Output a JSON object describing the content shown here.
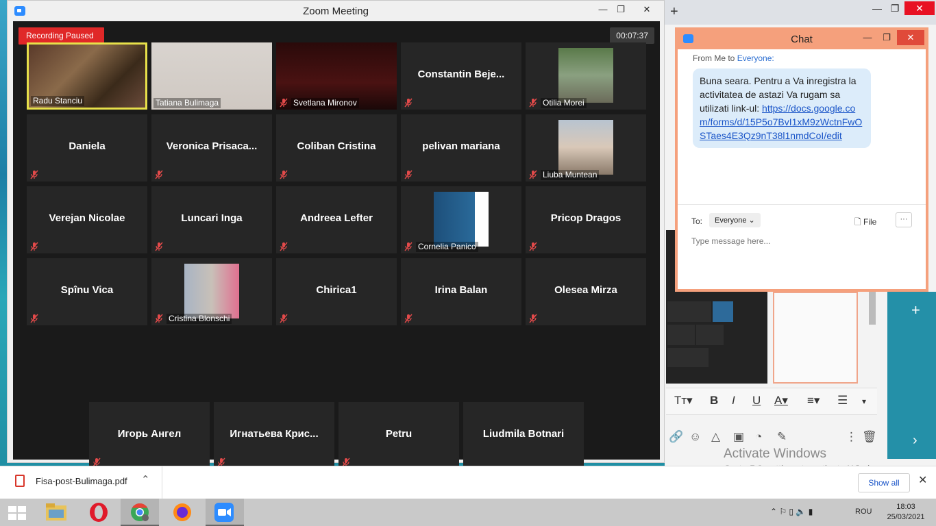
{
  "zoom": {
    "title": "Zoom Meeting",
    "recording_status": "Recording Paused",
    "timer": "00:07:37",
    "participants": [
      {
        "name": "Radu Stanciu",
        "display": "video",
        "active": true
      },
      {
        "name": "Tatiana Bulimaga",
        "display": "video"
      },
      {
        "name": "Svetlana Mironov",
        "display": "video"
      },
      {
        "name": "Constantin  Beje...",
        "display": "name"
      },
      {
        "name": "Otilia Morei",
        "display": "photo"
      },
      {
        "name": "Daniela",
        "display": "name"
      },
      {
        "name": "Veronica  Prisaca...",
        "display": "name"
      },
      {
        "name": "Coliban Cristina",
        "display": "name"
      },
      {
        "name": "pelivan mariana",
        "display": "name"
      },
      {
        "name": "Liuba Muntean",
        "display": "photo"
      },
      {
        "name": "Verejan Nicolae",
        "display": "name"
      },
      {
        "name": "Luncari Inga",
        "display": "name"
      },
      {
        "name": "Andreea Lefter",
        "display": "name"
      },
      {
        "name": "Cornelia Panico",
        "display": "photo"
      },
      {
        "name": "Pricop Dragos",
        "display": "name"
      },
      {
        "name": "Spînu Vica",
        "display": "name"
      },
      {
        "name": "Cristina Blonschi",
        "display": "photo"
      },
      {
        "name": "Chirica1",
        "display": "name"
      },
      {
        "name": "Irina Balan",
        "display": "name"
      },
      {
        "name": "Olesea Mirza",
        "display": "name"
      },
      {
        "name": "Игорь Ангел",
        "display": "name"
      },
      {
        "name": "Игнатьева  Крис...",
        "display": "name"
      },
      {
        "name": "Petru",
        "display": "name"
      },
      {
        "name": "Liudmila Botnari",
        "display": "name"
      }
    ]
  },
  "chat": {
    "title": "Chat",
    "from_prefix": "From Me to ",
    "from_target": "Everyone:",
    "message_text": "Buna seara. Pentru a Va inregistra la activitatea de astazi Va rugam sa utilizati link-ul:",
    "message_link": "https://docs.google.com/forms/d/15P5o7BvI1xM9zWctnFwOSTaes4E3Qz9nT38l1nmdCoI/edit",
    "to_label": "To:",
    "to_value": "Everyone",
    "file_label": "File",
    "more_label": "···",
    "input_placeholder": "Type message here..."
  },
  "download": {
    "filename": "Fisa-post-Bulimaga.pdf",
    "show_all": "Show all"
  },
  "background": {
    "activate_title": "Activate Windows",
    "activate_sub": "Go to PC settings to activate Windows."
  },
  "taskbar": {
    "language": "ROU",
    "time": "18:03",
    "date": "25/03/2021"
  }
}
